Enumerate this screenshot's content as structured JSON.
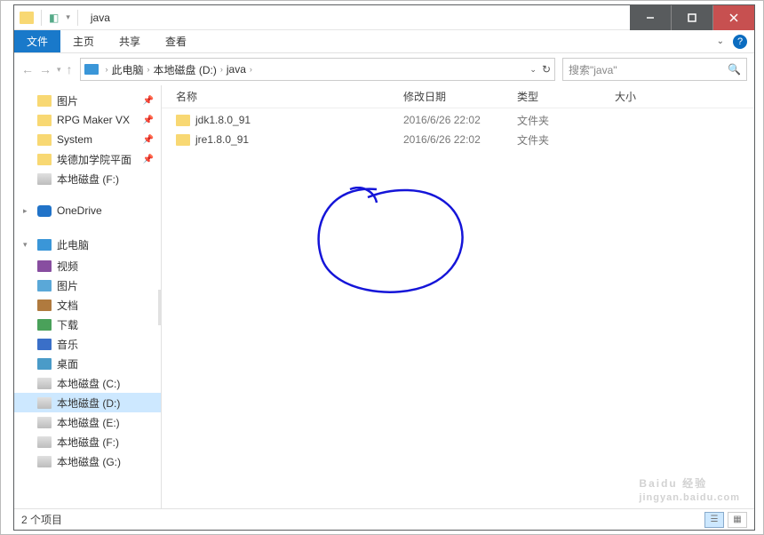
{
  "window": {
    "title": "java"
  },
  "ribbon": {
    "file": "文件",
    "tabs": [
      "主页",
      "共享",
      "查看"
    ]
  },
  "breadcrumbs": {
    "items": [
      "此电脑",
      "本地磁盘 (D:)",
      "java"
    ]
  },
  "search": {
    "placeholder": "搜索\"java\""
  },
  "tree": {
    "items": [
      {
        "label": "图片",
        "icon": "folder",
        "pin": true
      },
      {
        "label": "RPG Maker VX",
        "icon": "folder",
        "pin": true
      },
      {
        "label": "System",
        "icon": "folder",
        "pin": true
      },
      {
        "label": "埃德加学院平面",
        "icon": "folder",
        "pin": true
      },
      {
        "label": "本地磁盘 (F:)",
        "icon": "drive"
      }
    ],
    "onedrive": "OneDrive",
    "thispc": {
      "label": "此电脑",
      "children": [
        {
          "label": "视频",
          "icon": "vid"
        },
        {
          "label": "图片",
          "icon": "pic"
        },
        {
          "label": "文档",
          "icon": "doc"
        },
        {
          "label": "下载",
          "icon": "dl"
        },
        {
          "label": "音乐",
          "icon": "mus"
        },
        {
          "label": "桌面",
          "icon": "desk"
        },
        {
          "label": "本地磁盘 (C:)",
          "icon": "drive"
        },
        {
          "label": "本地磁盘 (D:)",
          "icon": "drive",
          "selected": true
        },
        {
          "label": "本地磁盘 (E:)",
          "icon": "drive"
        },
        {
          "label": "本地磁盘 (F:)",
          "icon": "drive"
        },
        {
          "label": "本地磁盘 (G:)",
          "icon": "drive"
        }
      ]
    }
  },
  "columns": {
    "name": "名称",
    "date": "修改日期",
    "type": "类型",
    "size": "大小"
  },
  "files": [
    {
      "name": "jdk1.8.0_91",
      "date": "2016/6/26 22:02",
      "type": "文件夹",
      "size": ""
    },
    {
      "name": "jre1.8.0_91",
      "date": "2016/6/26 22:02",
      "type": "文件夹",
      "size": ""
    }
  ],
  "status": {
    "count": "2 个项目"
  },
  "watermark": {
    "main": "Baidu 经验",
    "sub": "jingyan.baidu.com"
  }
}
